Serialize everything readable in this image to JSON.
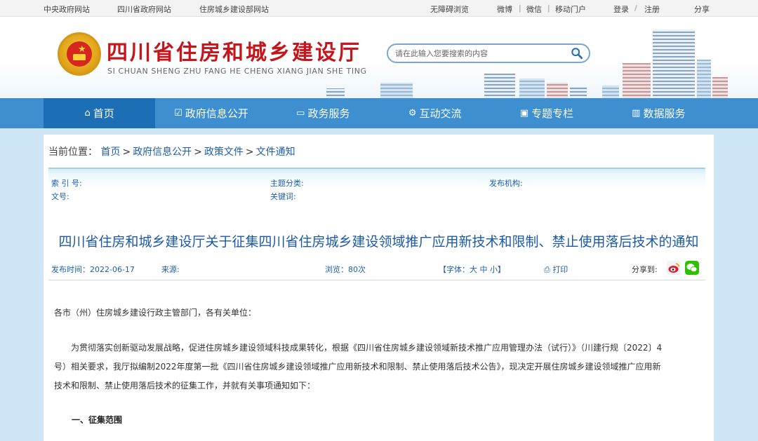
{
  "topbar": {
    "links_left": [
      "中央政府网站",
      "四川省政府网站",
      "住房城乡建设部网站"
    ],
    "accessibility": "无障碍浏览",
    "social": [
      "微博",
      "微信",
      "移动门户"
    ],
    "login": "登录",
    "register": "注册",
    "share": "分享",
    "sep": "|",
    "slash": "/"
  },
  "header": {
    "title": "四川省住房和城乡建设厅",
    "subtitle": "SI CHUAN SHENG ZHU FANG HE CHENG XIANG JIAN SHE TING",
    "search_placeholder": "请在此输入您要搜索的内容"
  },
  "nav": {
    "items": [
      {
        "label": "首页",
        "icon": "home-icon"
      },
      {
        "label": "政府信息公开",
        "icon": "edit-icon"
      },
      {
        "label": "政务服务",
        "icon": "monitor-icon"
      },
      {
        "label": "互动交流",
        "icon": "interaction-icon"
      },
      {
        "label": "专题专栏",
        "icon": "image-icon"
      },
      {
        "label": "数据服务",
        "icon": "chart-icon"
      }
    ]
  },
  "breadcrumb": {
    "prefix": "当前位置：",
    "items": [
      "首页",
      "政府信息公开",
      "政策文件",
      "文件通知"
    ],
    "sep": ">"
  },
  "meta": {
    "index_label": "索 引 号:",
    "topic_label": "主题分类:",
    "issuer_label": "发布机构:",
    "docno_label": "文号:",
    "keywords_label": "关键词:"
  },
  "article": {
    "title": "四川省住房和城乡建设厅关于征集四川省住房城乡建设领域推广应用新技术和限制、禁止使用落后技术的通知",
    "publish_time": "发布时间：2022-06-17",
    "source": "来源:",
    "views": "浏览：80次",
    "font_size": "【字体：",
    "font_large": "大",
    "font_medium": "中",
    "font_small": "小",
    "font_close": "】",
    "print": "打印",
    "share_to": "分享到:",
    "salutation": "各市（州）住房城乡建设行政主管部门，各有关单位：",
    "para1_line1": "为贯彻落实创新驱动发展战略，促进住房城乡建设领域科技成果转化，根据《四川省住房城乡建设领域新技术推广应用管理办法（试行）》（川建行规〔2022〕4",
    "para1_line2": "号）相关要求，我厅拟编制2022年度第一批《四川省住房城乡建设领域推广应用新技术和限制、禁止使用落后技术公告》，现决定开展住房城乡建设领域推广应用新",
    "para1_line3": "技术和限制、禁止使用落后技术的征集工作，并就有关事项通知如下：",
    "section1": "一、征集范围"
  },
  "colors": {
    "nav_bg": "#3d8fd0",
    "nav_active": "#1c6fb4",
    "title_red": "#c4161c",
    "link_blue": "#1f5ea8"
  }
}
